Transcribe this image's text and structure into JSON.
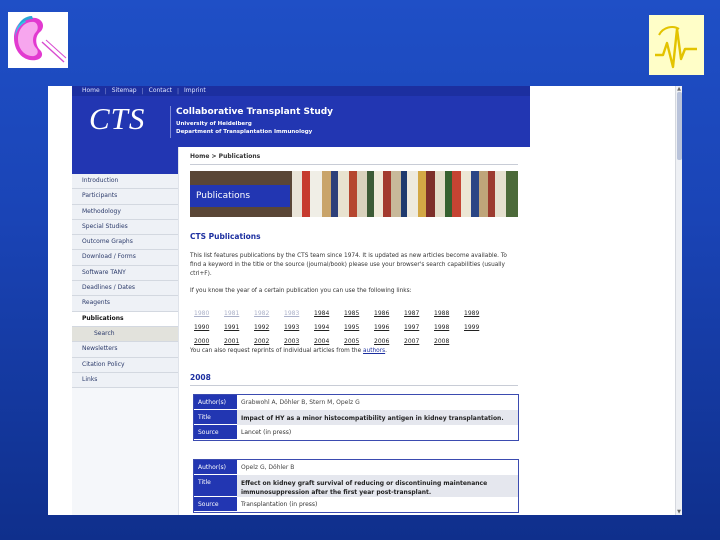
{
  "slide": {
    "logo_left_icon": "kidney-logo-icon",
    "logo_right_icon": "heartbeat-logo-icon"
  },
  "site": {
    "topnav": [
      "Home",
      "Sitemap",
      "Contact",
      "Imprint"
    ],
    "banner": {
      "logo": "CTS",
      "title": "Collaborative Transplant Study",
      "line1": "University of Heidelberg",
      "line2": "Department of Transplantation Immunology"
    },
    "breadcrumb": "Home > Publications",
    "sidebar": [
      {
        "label": "Introduction"
      },
      {
        "label": "Participants"
      },
      {
        "label": "Methodology"
      },
      {
        "label": "Special Studies"
      },
      {
        "label": "Outcome Graphs"
      },
      {
        "label": "Download / Forms"
      },
      {
        "label": "Software TANY"
      },
      {
        "label": "Deadlines / Dates"
      },
      {
        "label": "Reagents"
      },
      {
        "label": "Publications"
      },
      {
        "label": "Search"
      },
      {
        "label": "Newsletters"
      },
      {
        "label": "Citation Policy"
      },
      {
        "label": "Links"
      }
    ],
    "hero_label": "Publications",
    "heading": "CTS Publications",
    "intro": "This list features publications by the CTS team since 1974. It is updated as new articles become available. To find a keyword in the title or the source (journal/book) please use your browser's search capabilities (usually ctrl+F).",
    "years_intro": "If you know the year of a certain publication you can use the following links:",
    "years": [
      [
        "1980",
        "1981",
        "1982",
        "1983",
        "1984",
        "1985",
        "1986",
        "1987",
        "1988",
        "1989"
      ],
      [
        "1990",
        "1991",
        "1992",
        "1993",
        "1994",
        "1995",
        "1996",
        "1997",
        "1998",
        "1999"
      ],
      [
        "2000",
        "2001",
        "2002",
        "2003",
        "2004",
        "2005",
        "2006",
        "2007",
        "2008"
      ]
    ],
    "reprints_text": "You can also request reprints of individual articles from the",
    "reprints_link": "authors",
    "reprints_end": ".",
    "year_heading": "2008",
    "labels": {
      "author": "Author(s)",
      "title": "Title",
      "source": "Source"
    },
    "publications": [
      {
        "authors": "Grabwohl A, Döhler B, Stern M, Opelz G",
        "title": "Impact of HY as a minor histocompatibility antigen in kidney transplantation.",
        "source": "Lancet (in press)"
      },
      {
        "authors": "Opelz G, Döhler B",
        "title": "Effect on kidney graft survival of reducing or discontinuing maintenance immunosuppression after the first year post-transplant.",
        "source": "Transplantation (in press)"
      }
    ]
  },
  "colors": {
    "slide_background": "#1a44b6",
    "site_navy": "#2236b2",
    "link_blue": "#1c2fa0"
  }
}
